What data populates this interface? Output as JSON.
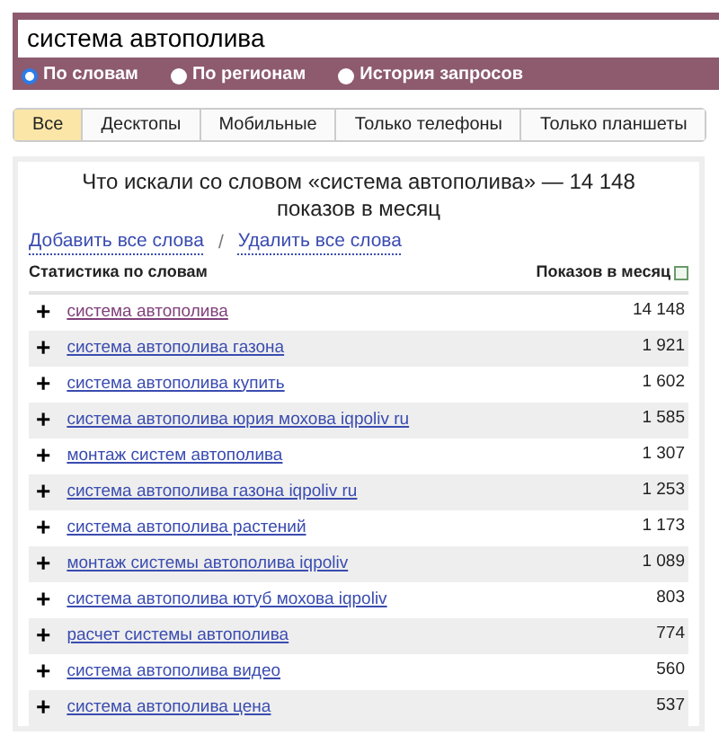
{
  "search": {
    "value": "система автополива"
  },
  "modes": [
    {
      "label": "По словам",
      "selected": true
    },
    {
      "label": "По регионам",
      "selected": false
    },
    {
      "label": "История запросов",
      "selected": false
    }
  ],
  "tabs": [
    {
      "label": "Все",
      "selected": true
    },
    {
      "label": "Десктопы",
      "selected": false
    },
    {
      "label": "Мобильные",
      "selected": false
    },
    {
      "label": "Только телефоны",
      "selected": false
    },
    {
      "label": "Только планшеты",
      "selected": false
    }
  ],
  "panel": {
    "title": "Что искали со словом «система автополива» — 14 148 показов в месяц",
    "add_all": "Добавить все слова",
    "separator": "/",
    "remove_all": "Удалить все слова",
    "columns": [
      "Статистика по словам",
      "Показов в месяц"
    ],
    "add_icon": "+",
    "rows": [
      {
        "phrase": "система автополива",
        "count": "14 148",
        "visited": true
      },
      {
        "phrase": "система автополива газона",
        "count": "1 921",
        "visited": false
      },
      {
        "phrase": "система автополива купить",
        "count": "1 602",
        "visited": false
      },
      {
        "phrase": "система автополива юрия мохова iqpoliv ru",
        "count": "1 585",
        "visited": false
      },
      {
        "phrase": "монтаж систем автополива",
        "count": "1 307",
        "visited": false
      },
      {
        "phrase": "система автополива газона iqpoliv ru",
        "count": "1 253",
        "visited": false
      },
      {
        "phrase": "система автополива растений",
        "count": "1 173",
        "visited": false
      },
      {
        "phrase": "монтаж системы автополива iqpoliv",
        "count": "1 089",
        "visited": false
      },
      {
        "phrase": "система автополива ютуб мохова iqpoliv",
        "count": "803",
        "visited": false
      },
      {
        "phrase": "расчет системы автополива",
        "count": "774",
        "visited": false
      },
      {
        "phrase": "система автополива видео",
        "count": "560",
        "visited": false
      },
      {
        "phrase": "система автополива цена",
        "count": "537",
        "visited": false
      }
    ]
  }
}
